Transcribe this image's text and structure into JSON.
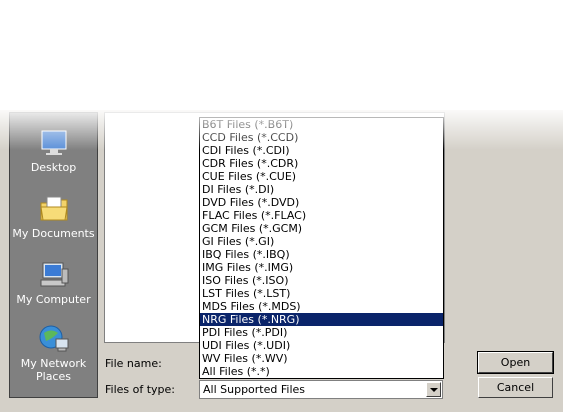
{
  "places": [
    {
      "label": "Desktop",
      "icon": "desktop-icon"
    },
    {
      "label": "My Documents",
      "icon": "my-documents-icon"
    },
    {
      "label": "My Computer",
      "icon": "my-computer-icon"
    },
    {
      "label": "My Network Places",
      "icon": "network-places-icon"
    }
  ],
  "file_name": {
    "label": "File name:",
    "value": ""
  },
  "files_of_type": {
    "label": "Files of type:",
    "value": "All Supported Files"
  },
  "type_options": [
    "B6T Files (*.B6T)",
    "CCD Files (*.CCD)",
    "CDI Files (*.CDI)",
    "CDR Files (*.CDR)",
    "CUE Files (*.CUE)",
    "DI Files (*.DI)",
    "DVD Files (*.DVD)",
    "FLAC Files (*.FLAC)",
    "GCM Files (*.GCM)",
    "GI Files (*.GI)",
    "IBQ Files (*.IBQ)",
    "IMG Files (*.IMG)",
    "ISO Files (*.ISO)",
    "LST Files (*.LST)",
    "MDS Files (*.MDS)",
    "NRG Files (*.NRG)",
    "PDI Files (*.PDI)",
    "UDI Files (*.UDI)",
    "WV Files (*.WV)",
    "All Files (*.*)"
  ],
  "selected_option": "NRG Files (*.NRG)",
  "buttons": {
    "open": "Open",
    "cancel": "Cancel"
  },
  "colors": {
    "selection": "#0a246a",
    "dialog_bg": "#d4d0c8",
    "places_bg": "#808080"
  }
}
